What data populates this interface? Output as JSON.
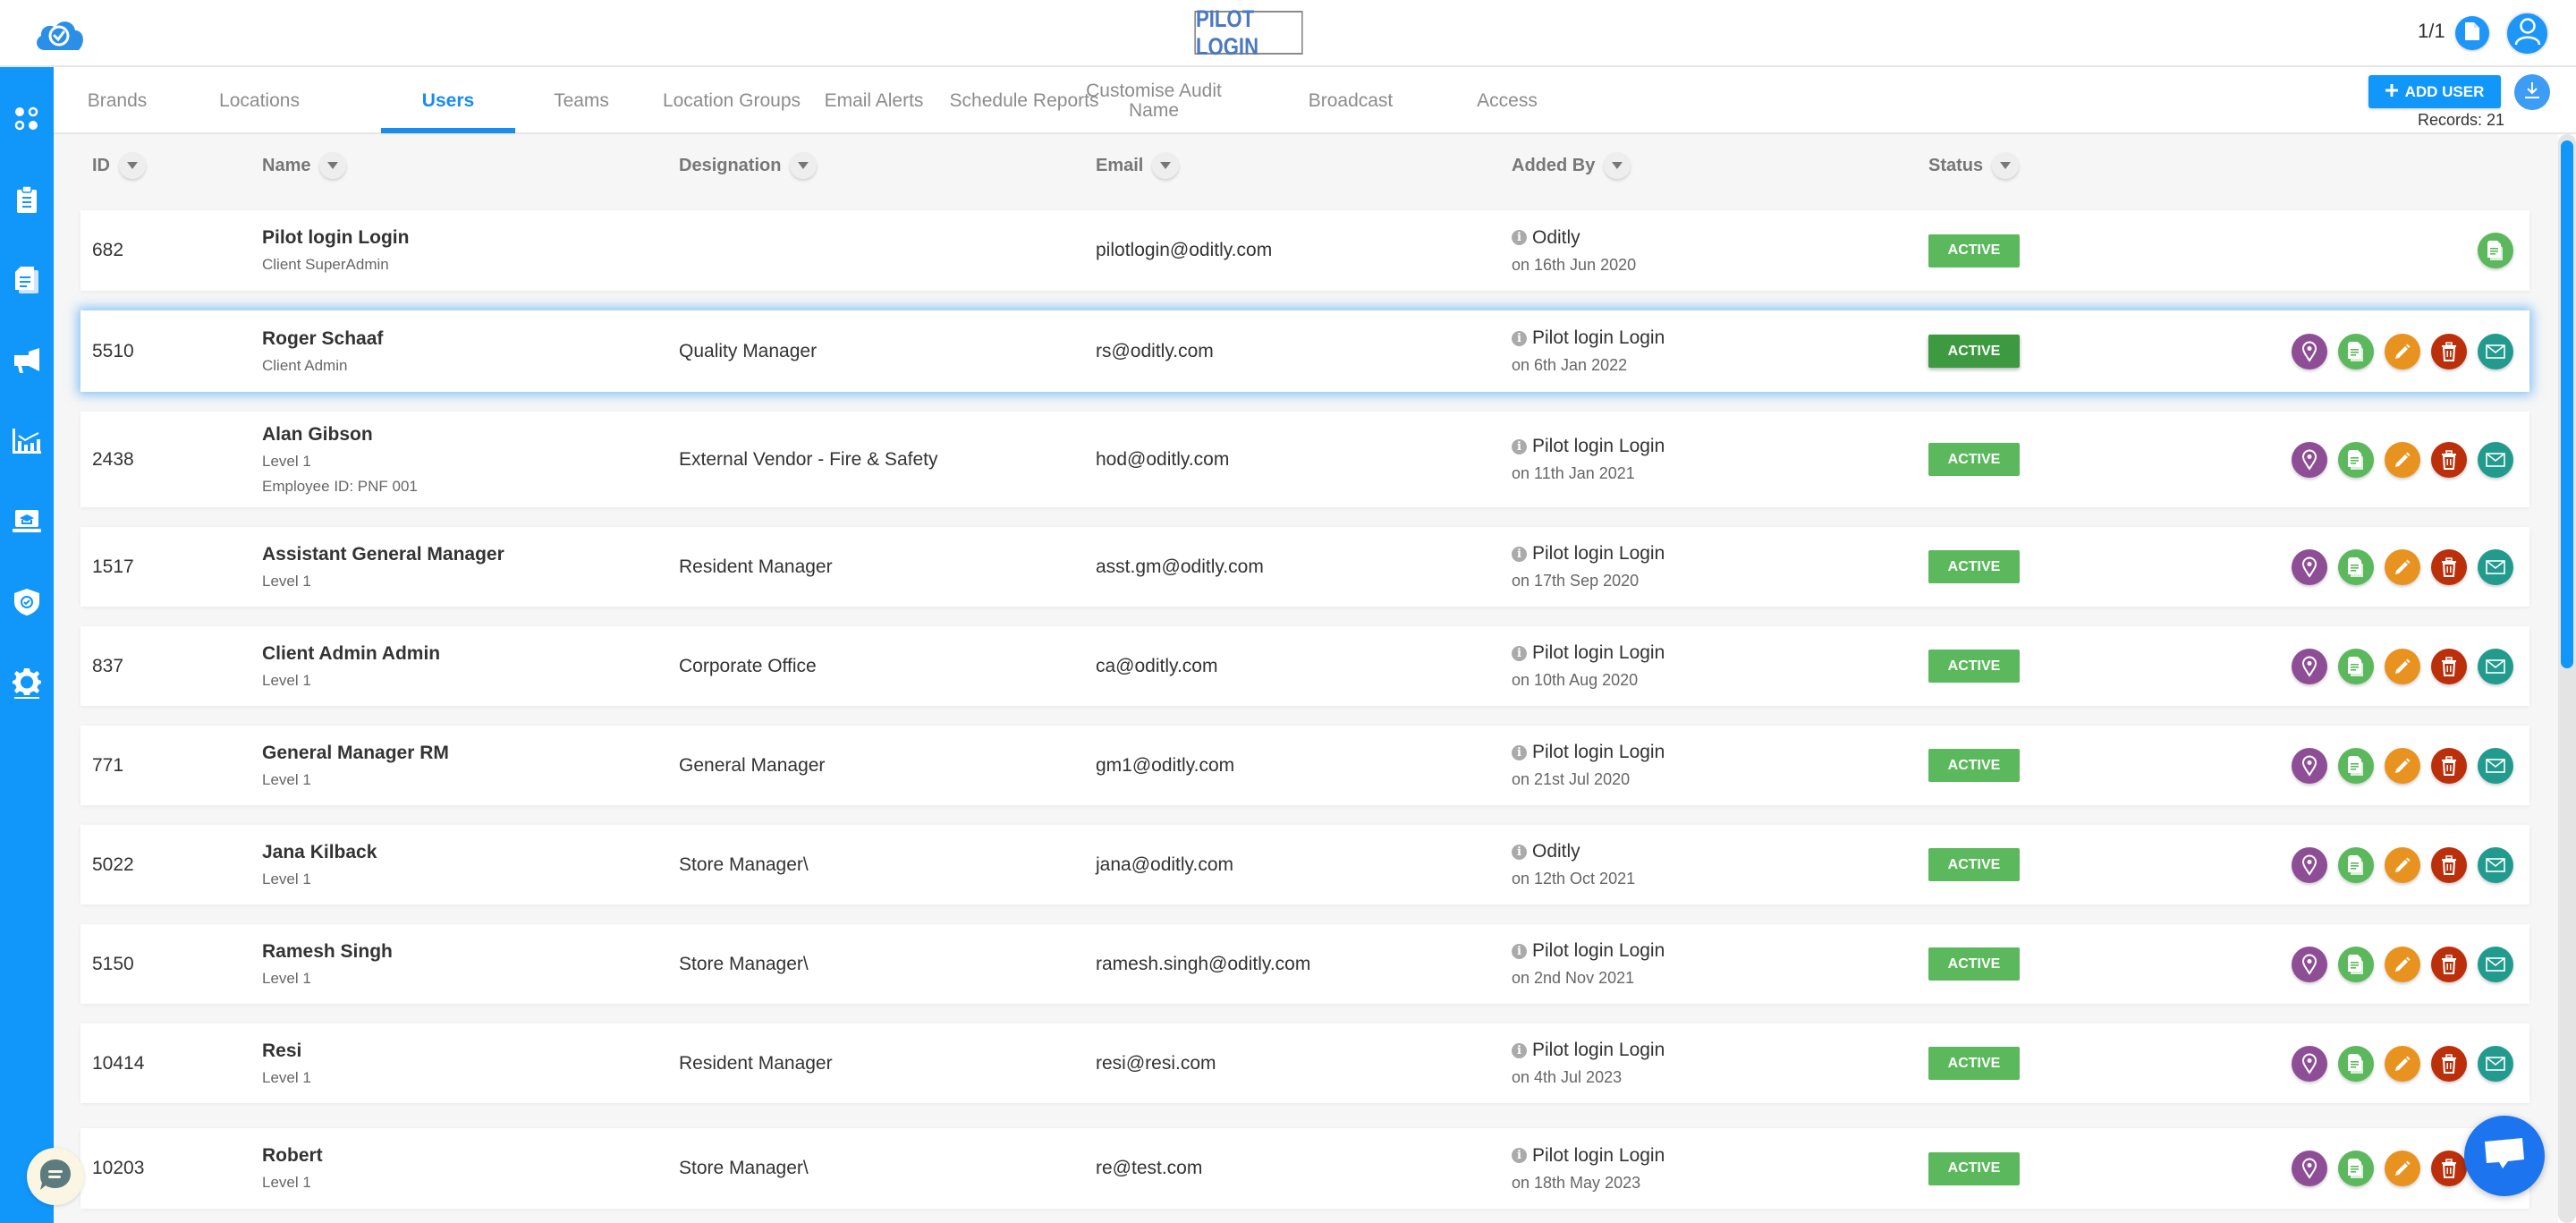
{
  "header": {
    "brand_title": "PILOT LOGIN",
    "page_count": "1/1",
    "logo_icon": "cloud-check-icon",
    "page_icon": "document-icon",
    "avatar_icon": "user-icon"
  },
  "sidebar": {
    "items": [
      {
        "name": "dashboard",
        "icon": "apps-dots-icon"
      },
      {
        "name": "audits",
        "icon": "clipboard-icon"
      },
      {
        "name": "reports",
        "icon": "documents-icon"
      },
      {
        "name": "broadcast",
        "icon": "megaphone-icon"
      },
      {
        "name": "analytics",
        "icon": "chart-icon"
      },
      {
        "name": "training",
        "icon": "graduation-laptop-icon"
      },
      {
        "name": "compliance",
        "icon": "shield-check-icon"
      },
      {
        "name": "settings",
        "icon": "gear-icon",
        "active": true
      }
    ]
  },
  "tabs": [
    {
      "label": "Brands"
    },
    {
      "label": "Locations"
    },
    {
      "label": "Users",
      "active": true
    },
    {
      "label": "Teams"
    },
    {
      "label": "Location Groups"
    },
    {
      "label": "Email Alerts"
    },
    {
      "label": "Schedule Reports"
    },
    {
      "label": "Customise Audit Name"
    },
    {
      "label": "Broadcast"
    },
    {
      "label": "Access"
    }
  ],
  "toolbar": {
    "add_user_label": "ADD USER",
    "add_user_icon": "plus-icon",
    "download_icon": "download-icon",
    "records_label": "Records: 21"
  },
  "table": {
    "columns": [
      "ID",
      "Name",
      "Designation",
      "Email",
      "Added By",
      "Status"
    ],
    "rows": [
      {
        "id": "682",
        "name": "Pilot login Login",
        "role": "Client SuperAdmin",
        "extra": "",
        "designation": "",
        "email": "pilotlogin@oditly.com",
        "added_by": "Oditly",
        "added_on": "on 16th Jun 2020",
        "status": "ACTIVE",
        "actions": [
          "document"
        ]
      },
      {
        "id": "5510",
        "name": "Roger Schaaf",
        "role": "Client Admin",
        "extra": "",
        "designation": "Quality Manager",
        "email": "rs@oditly.com",
        "added_by": "Pilot login Login",
        "added_on": "on 6th Jan 2022",
        "status": "ACTIVE",
        "highlighted": true,
        "actions": [
          "location",
          "document",
          "edit",
          "delete",
          "email"
        ]
      },
      {
        "id": "2438",
        "name": "Alan Gibson",
        "role": "Level 1",
        "extra": "Employee ID: PNF 001",
        "designation": "External Vendor - Fire & Safety",
        "email": "hod@oditly.com",
        "added_by": "Pilot login Login",
        "added_on": "on 11th Jan 2021",
        "status": "ACTIVE",
        "actions": [
          "location",
          "document",
          "edit",
          "delete",
          "email"
        ]
      },
      {
        "id": "1517",
        "name": "Assistant General Manager",
        "role": "Level 1",
        "extra": "",
        "designation": "Resident Manager",
        "email": "asst.gm@oditly.com",
        "added_by": "Pilot login Login",
        "added_on": "on 17th Sep 2020",
        "status": "ACTIVE",
        "actions": [
          "location",
          "document",
          "edit",
          "delete",
          "email"
        ]
      },
      {
        "id": "837",
        "name": "Client Admin Admin",
        "role": "Level 1",
        "extra": "",
        "designation": "Corporate Office",
        "email": "ca@oditly.com",
        "added_by": "Pilot login Login",
        "added_on": "on 10th Aug 2020",
        "status": "ACTIVE",
        "actions": [
          "location",
          "document",
          "edit",
          "delete",
          "email"
        ]
      },
      {
        "id": "771",
        "name": "General Manager RM",
        "role": "Level 1",
        "extra": "",
        "designation": "General Manager",
        "email": "gm1@oditly.com",
        "added_by": "Pilot login Login",
        "added_on": "on 21st Jul 2020",
        "status": "ACTIVE",
        "actions": [
          "location",
          "document",
          "edit",
          "delete",
          "email"
        ]
      },
      {
        "id": "5022",
        "name": "Jana Kilback",
        "role": "Level 1",
        "extra": "",
        "designation": "Store Manager\\",
        "email": "jana@oditly.com",
        "added_by": "Oditly",
        "added_on": "on 12th Oct 2021",
        "status": "ACTIVE",
        "actions": [
          "location",
          "document",
          "edit",
          "delete",
          "email"
        ]
      },
      {
        "id": "5150",
        "name": "Ramesh Singh",
        "role": "Level 1",
        "extra": "",
        "designation": "Store Manager\\",
        "email": "ramesh.singh@oditly.com",
        "added_by": "Pilot login Login",
        "added_on": "on 2nd Nov 2021",
        "status": "ACTIVE",
        "actions": [
          "location",
          "document",
          "edit",
          "delete",
          "email"
        ]
      },
      {
        "id": "10414",
        "name": "Resi",
        "role": "Level 1",
        "extra": "",
        "designation": "Resident Manager",
        "email": "resi@resi.com",
        "added_by": "Pilot login Login",
        "added_on": "on 4th Jul 2023",
        "status": "ACTIVE",
        "actions": [
          "location",
          "document",
          "edit",
          "delete",
          "email"
        ]
      },
      {
        "id": "10203",
        "name": "Robert",
        "role": "Level 1",
        "extra": "",
        "designation": "Store Manager\\",
        "email": "re@test.com",
        "added_by": "Pilot login Login",
        "added_on": "on 18th May 2023",
        "status": "ACTIVE",
        "actions": [
          "location",
          "document",
          "edit",
          "delete",
          "email"
        ]
      }
    ]
  },
  "colors": {
    "primary": "#1196f9",
    "active_badge": "#5cb85c",
    "action_location": "#8e4e95",
    "action_document": "#5cb85c",
    "action_edit": "#e8931f",
    "action_delete": "#bb2f0b",
    "action_email": "#229b8e"
  },
  "widgets": {
    "chat_left_icon": "chat-bubble-icon",
    "chat_right_icon": "message-icon"
  }
}
